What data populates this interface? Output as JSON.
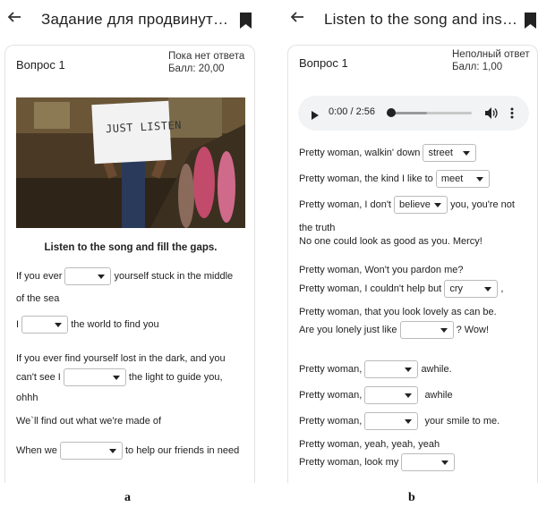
{
  "panel_a": {
    "back_icon": "arrow-left-icon",
    "title": "Задание для продвинут…",
    "bookmark_icon": "bookmark-icon",
    "question_label": "Вопрос 1",
    "status_line1": "Пока нет ответа",
    "status_line2": "Балл: 20,00",
    "sign_text": "JUST LISTEN",
    "instruction": "Listen to the song and fill the gaps.",
    "lines": {
      "l1a": "If you ever",
      "l1b": "yourself stuck in the middle",
      "l2": "of the sea",
      "l3a": "I",
      "l3b": "the world to find you",
      "l4": "If you ever find yourself lost in the dark, and you",
      "l5a": "can't see I",
      "l5b": "the light to guide you,",
      "l6": "ohhh",
      "l7": "We`ll find out what we're made of",
      "l8a": "When we",
      "l8b": "to help our friends in need"
    }
  },
  "panel_b": {
    "back_icon": "arrow-left-icon",
    "title": "Listen to the song and ins…",
    "bookmark_icon": "bookmark-icon",
    "question_label": "Вопрос 1",
    "status_line1": "Неполный ответ",
    "status_line2": "Балл: 1,00",
    "audio": {
      "time": "0:00 / 2:56",
      "progress": 0.0
    },
    "lines": {
      "b1": "Pretty woman, walkin' down",
      "b1v": "street",
      "b2": "Pretty woman, the kind I like to",
      "b2v": "meet",
      "b3": "Pretty woman, I don't",
      "b3v": "believe",
      "b3b": "you, you're not",
      "b4": "the truth",
      "b5": "No one could look as good as you. Mercy!",
      "b6": "Pretty woman, Won't you pardon me?",
      "b7": "Pretty woman, I couldn't help but",
      "b7v": "cry",
      "b7b": ",",
      "b8": "Pretty woman, that you look lovely as can be.",
      "b9": "Are you lonely just like",
      "b9b": "? Wow!",
      "b10": "Pretty woman,",
      "b10b": "awhile.",
      "b11": "Pretty woman,",
      "b11b": "awhile",
      "b12": "Pretty woman,",
      "b12b": "your smile to me.",
      "b13": "Pretty woman, yeah, yeah, yeah",
      "b14": "Pretty woman, look my"
    }
  },
  "captions": {
    "a": "a",
    "b": "b"
  }
}
